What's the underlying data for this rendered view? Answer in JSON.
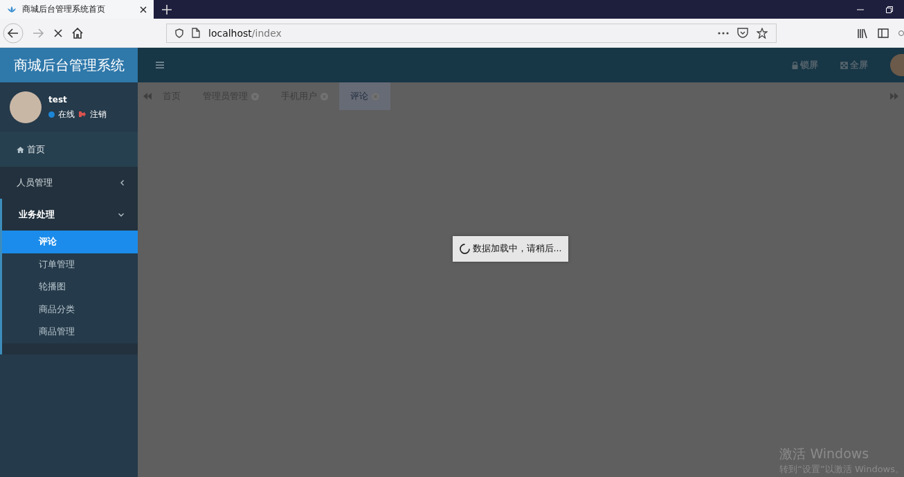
{
  "browser": {
    "tab_title": "商城后台管理系统首页",
    "url_host": "localhost",
    "url_path": "/index"
  },
  "header": {
    "logo_title": "商城后台管理系统",
    "actions": [
      {
        "kind": "lock",
        "label": "锁屏"
      },
      {
        "kind": "expand",
        "label": "全屏"
      }
    ]
  },
  "user": {
    "name": "test",
    "status": "在线",
    "logout": "注销"
  },
  "menu": [
    {
      "kind": "link",
      "label": "首页"
    },
    {
      "kind": "group",
      "label": "人员管理",
      "expanded": false
    },
    {
      "kind": "group",
      "label": "业务处理",
      "expanded": true,
      "children": [
        {
          "label": "评论",
          "selected": true
        },
        {
          "label": "订单管理",
          "selected": false
        },
        {
          "label": "轮播图",
          "selected": false
        },
        {
          "label": "商品分类",
          "selected": false
        },
        {
          "label": "商品管理",
          "selected": false
        }
      ]
    }
  ],
  "page_tabs": [
    {
      "label": "首页",
      "closable": false,
      "selected": false
    },
    {
      "label": "管理员管理",
      "closable": true,
      "selected": false
    },
    {
      "label": "手机用户",
      "closable": true,
      "selected": false
    },
    {
      "label": "评论",
      "closable": true,
      "selected": true
    }
  ],
  "loading": {
    "message": "数据加载中，请稍后..."
  },
  "os_notice": {
    "title": "激活 Windows",
    "subtitle": "转到“设置”以激活 Windows。"
  }
}
